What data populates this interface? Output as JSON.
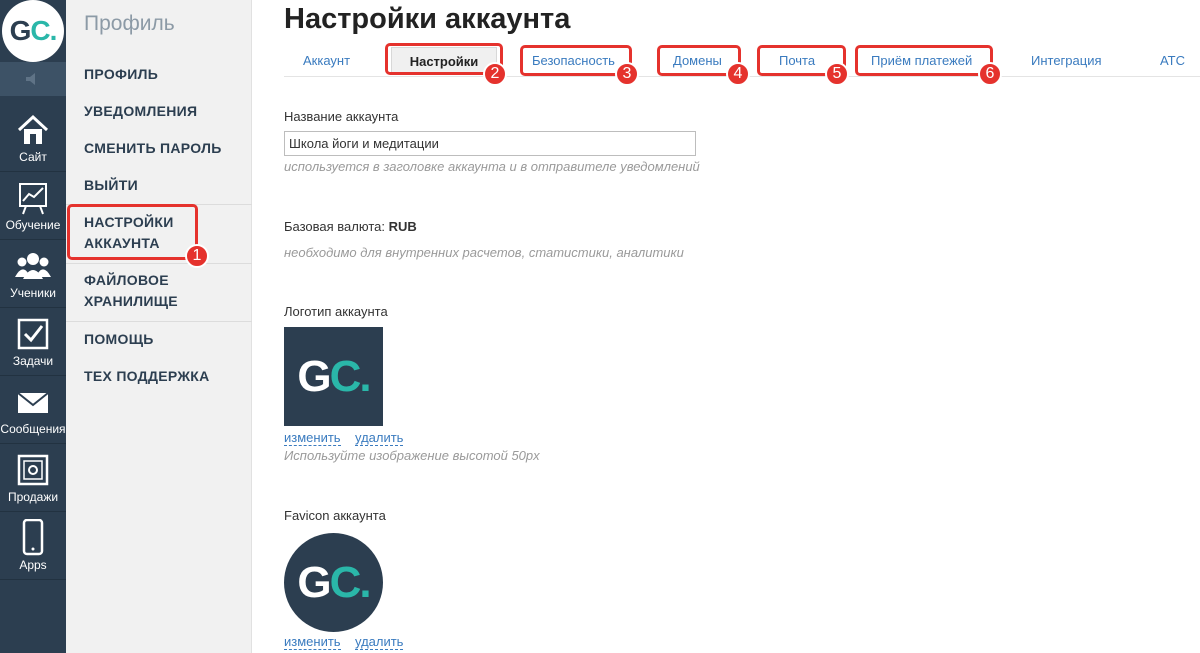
{
  "logo": {
    "g": "G",
    "c": "C",
    "dot": "."
  },
  "rail": {
    "collapse_icon": "speaker-icon",
    "items": [
      {
        "label": "Сайт",
        "icon": "home-icon"
      },
      {
        "label": "Обучение",
        "icon": "chart-easel-icon"
      },
      {
        "label": "Ученики",
        "icon": "users-icon"
      },
      {
        "label": "Задачи",
        "icon": "checkbox-icon"
      },
      {
        "label": "Сообщения",
        "icon": "envelope-icon"
      },
      {
        "label": "Продажи",
        "icon": "safe-icon"
      },
      {
        "label": "Apps",
        "icon": "phone-icon"
      }
    ]
  },
  "menu": {
    "title": "Профиль",
    "items": {
      "profile": "ПРОФИЛЬ",
      "notifications": "УВЕДОМЛЕНИЯ",
      "change_password": "СМЕНИТЬ ПАРОЛЬ",
      "logout": "ВЫЙТИ",
      "account_settings_1": "НАСТРОЙКИ",
      "account_settings_2": "АККАУНТА",
      "file_storage_1": "ФАЙЛОВОЕ",
      "file_storage_2": "ХРАНИЛИЩЕ",
      "help": "ПОМОЩЬ",
      "support": "ТЕХ ПОДДЕРЖКА"
    }
  },
  "page": {
    "title": "Настройки аккаунта"
  },
  "tabs": {
    "account": "Аккаунт",
    "settings": "Настройки",
    "security": "Безопасность",
    "domains": "Домены",
    "mail": "Почта",
    "payments": "Приём платежей",
    "integration": "Интеграция",
    "ats": "АТС"
  },
  "badges": {
    "b1": "1",
    "b2": "2",
    "b3": "3",
    "b4": "4",
    "b5": "5",
    "b6": "6"
  },
  "annotation_color": "#e5322d",
  "form": {
    "account_name_label": "Название аккаунта",
    "account_name_value": "Школа йоги и медитации",
    "account_name_hint": "используется в заголовке аккаунта и в отправителе уведомлений",
    "currency_label": "Базовая валюта:",
    "currency_value": "RUB",
    "currency_hint": "необходимо для внутренних расчетов, статистики, аналитики",
    "logo_label": "Логотип аккаунта",
    "logo_change": "изменить",
    "logo_delete": "удалить",
    "logo_hint": "Используйте изображение высотой 50px",
    "favicon_label": "Favicon аккаунта",
    "favicon_change": "изменить",
    "favicon_delete": "удалить"
  },
  "colors": {
    "sidebar_dark": "#2c3e50",
    "brand_teal": "#2ab7a9",
    "link_blue": "#3a7bbf"
  }
}
